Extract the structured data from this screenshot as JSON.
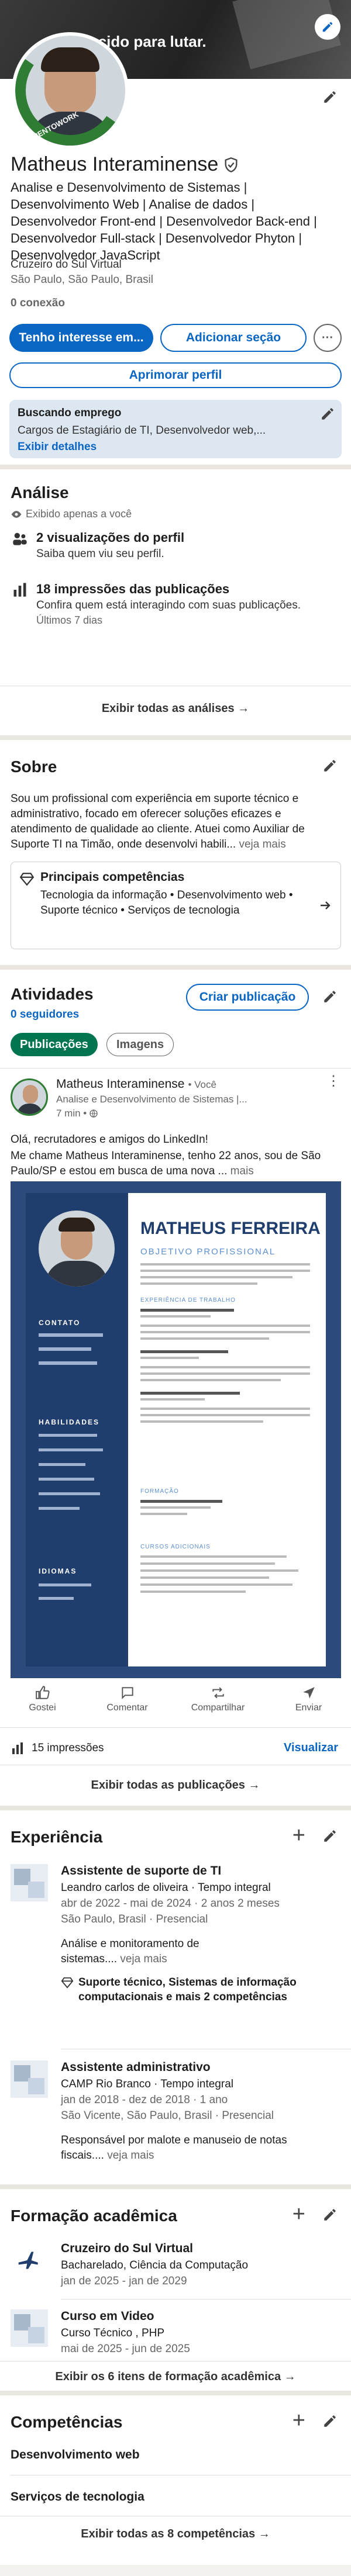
{
  "profile": {
    "banner_text": "Nascido para lutar.",
    "avatar_badge": "#OPENTOWORK",
    "name": "Matheus Interaminense",
    "headline": "Analise e Desenvolvimento de Sistemas | Desenvolvimento Web | Analise de dados | Desenvolvedor Front-end | Desenvolvedor Back-end | Desenvolvedor Full-stack | Desenvolvedor Phyton | Desenvolvedor JavaScript",
    "school": "Cruzeiro do Sul Virtual",
    "location": "São Paulo, São Paulo, Brasil",
    "connections": "0 conexão",
    "btn_interest": "Tenho interesse em...",
    "btn_add_section": "Adicionar seção",
    "btn_more": "···",
    "btn_improve": "Aprimorar perfil",
    "job_search_title": "Buscando emprego",
    "job_search_desc": "Cargos de Estagiário de TI, Desenvolvedor web,...",
    "job_search_link": "Exibir detalhes"
  },
  "analytics": {
    "title": "Análise",
    "visibility": "Exibido apenas a você",
    "views_title": "2 visualizações do perfil",
    "views_desc": "Saiba quem viu seu perfil.",
    "impressions_title": "18 impressões das publicações",
    "impressions_desc": "Confira quem está interagindo com suas publicações.",
    "impressions_period": "Últimos 7 dias",
    "show_all": "Exibir todas as análises →"
  },
  "about": {
    "title": "Sobre",
    "text": "Sou um profissional com experiência em suporte técnico e administrativo, focado em oferecer soluções eficazes e atendimento de qualidade ao cliente. Atuei como Auxiliar de Suporte TI na Timão, onde desenvolvi habili...",
    "more": "veja mais",
    "skills_title": "Principais competências",
    "skills_text": "Tecnologia da informação • Desenvolvimento web • Suporte técnico • Serviços de tecnologia"
  },
  "activity": {
    "title": "Atividades",
    "followers": "0 seguidores",
    "create_btn": "Criar publicação",
    "tab_posts": "Publicações",
    "tab_images": "Imagens",
    "post_author": "Matheus Interaminense",
    "post_you": "• Você",
    "post_headline": "Analise e Desenvolvimento de Sistemas |...",
    "post_time": "7 min •",
    "post_text_1": "Olá, recrutadores e amigos do LinkedIn!",
    "post_text_2": " Me chame Matheus Interaminense, tenho 22 anos, sou de São Paulo/SP e estou em busca de uma nova ...",
    "post_more": "mais",
    "resume_name": "MATHEUS FERREIRA",
    "resume_obj": "OBJETIVO PROFISSIONAL",
    "resume_contact": "CONTATO",
    "resume_skills": "HABILIDADES",
    "resume_lang": "IDIOMAS",
    "resume_exp": "EXPERIÊNCIA DE TRABALHO",
    "resume_edu": "FORMAÇÃO",
    "resume_courses": "CURSOS ADICIONAIS",
    "action_like": "Gostei",
    "action_comment": "Comentar",
    "action_share": "Compartilhar",
    "action_send": "Enviar",
    "impressions": "15 impressões",
    "view_link": "Visualizar",
    "show_all": "Exibir todas as publicações →"
  },
  "experience": {
    "title": "Experiência",
    "items": [
      {
        "role": "Assistente de suporte de TI",
        "company": "Leandro carlos de oliveira · Tempo integral",
        "dates": "abr de 2022 - mai de 2024 · 2 anos 2 meses",
        "place": "São Paulo, Brasil · Presencial",
        "desc": "Análise e monitoramento de sistemas....",
        "more": "veja mais",
        "skills": "Suporte técnico, Sistemas de informação computacionais e mais 2 competências"
      },
      {
        "role": "Assistente administrativo",
        "company": "CAMP Rio Branco · Tempo integral",
        "dates": "jan de 2018 - dez de 2018 · 1 ano",
        "place": "São Vicente, São Paulo, Brasil · Presencial",
        "desc": "Responsável por malote e manuseio de notas fiscais....",
        "more": "veja mais"
      }
    ]
  },
  "education": {
    "title": "Formação acadêmica",
    "items": [
      {
        "school": "Cruzeiro do Sul Virtual",
        "degree": "Bacharelado, Ciência da Computação",
        "dates": "jan de 2025 - jan de 2029"
      },
      {
        "school": "Curso em Video",
        "degree": "Curso Técnico , PHP",
        "dates": "mai de 2025 - jun de 2025"
      }
    ],
    "show_all": "Exibir os 6 itens de formação acadêmica →"
  },
  "skills": {
    "title": "Competências",
    "items": [
      "Desenvolvimento web",
      "Serviços de tecnologia"
    ],
    "show_all": "Exibir todas as 8 competências →"
  },
  "colors": {
    "accent": "#0a66c2",
    "badge_green": "#2e7d32",
    "banner": "#2b2b2b"
  }
}
